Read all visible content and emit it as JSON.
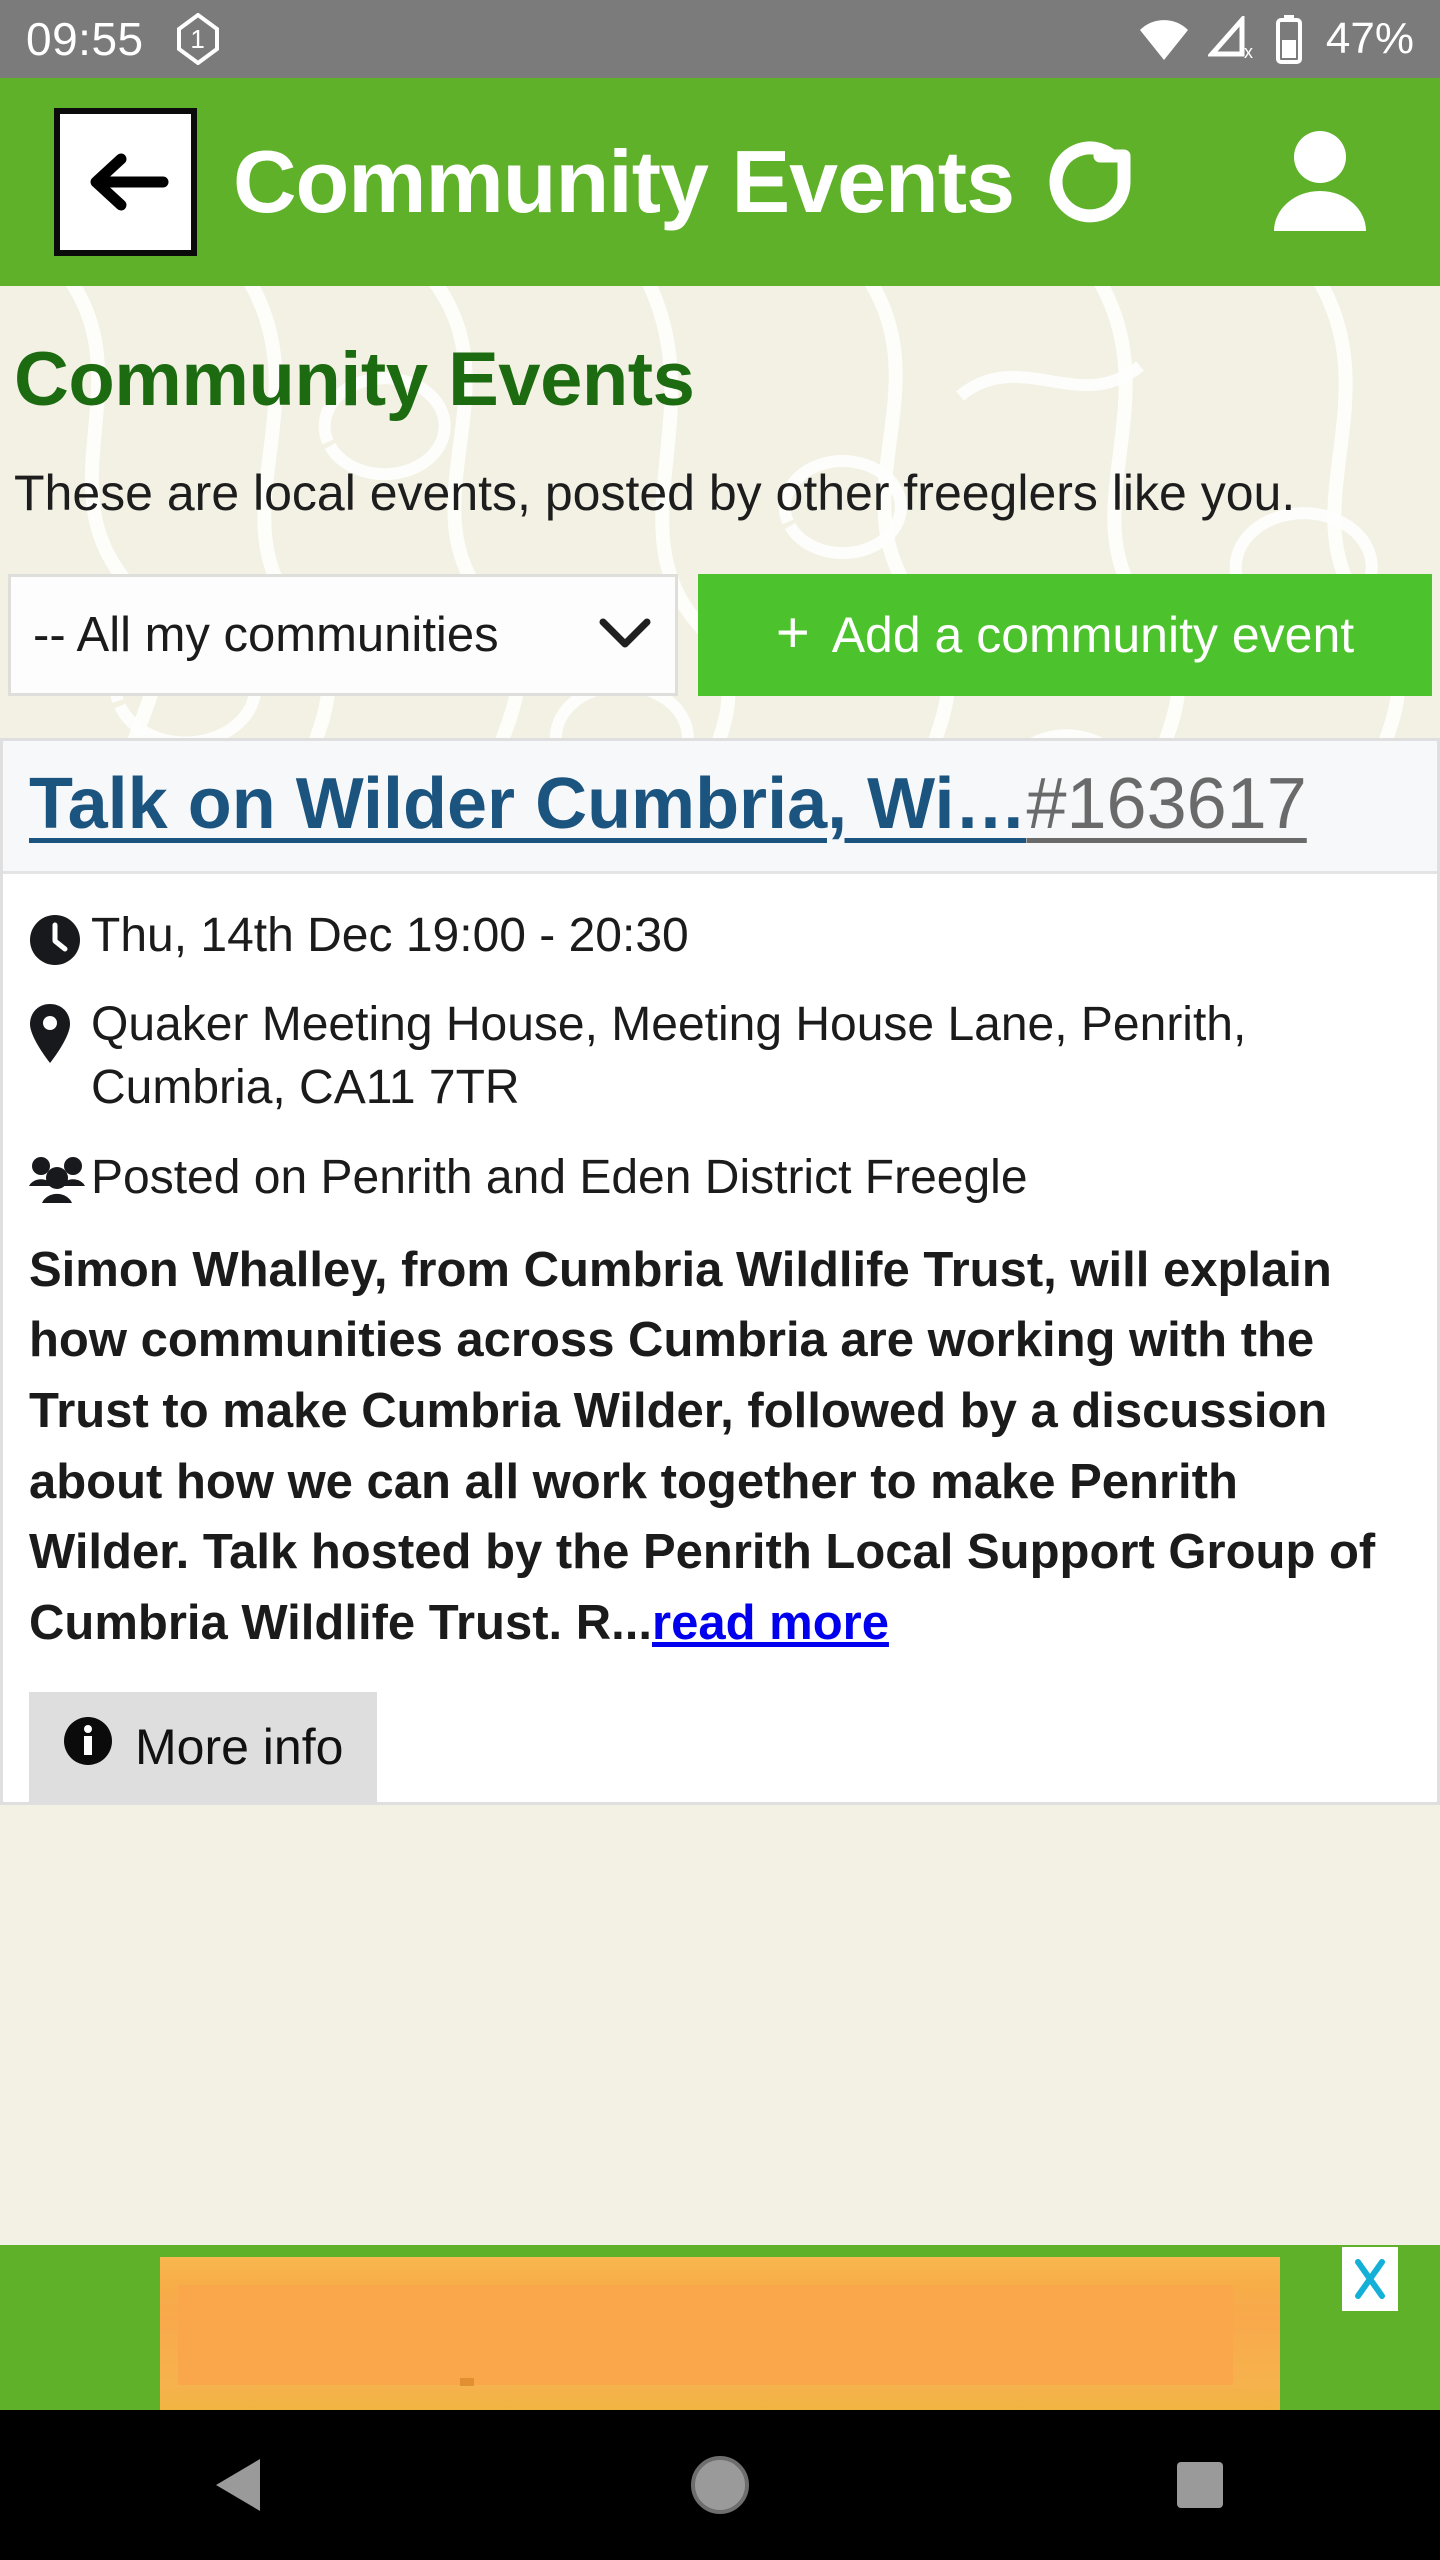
{
  "status_bar": {
    "time": "09:55",
    "notification_badge": "1",
    "battery_percent": "47%",
    "icons": [
      "wifi-icon",
      "no-signal-icon",
      "battery-icon"
    ],
    "bg_color": "#7b7b7b"
  },
  "app_bar": {
    "title": "Community Events",
    "back_label": "←",
    "refresh_icon": "refresh-icon",
    "profile_icon": "profile-icon",
    "bg_color": "#5fb12a"
  },
  "page": {
    "title": "Community Events",
    "description": "These are local events, posted by other freeglers like you.",
    "title_color": "#1d6b11",
    "bg_color": "#f2f1e4"
  },
  "controls": {
    "community_select": {
      "value": "-- All my communities",
      "caret_icon": "chevron-down-icon"
    },
    "add_event_button": {
      "plus": "+",
      "label": "Add a community event",
      "bg_color": "#4cc22c"
    }
  },
  "event_card": {
    "title": "Talk on Wilder Cumbria, Wi…",
    "id": "#163617",
    "title_color": "#1c5480",
    "when": {
      "icon": "clock-icon",
      "text": "Thu, 14th Dec 19:00 - 20:30"
    },
    "where": {
      "icon": "map-pin-icon",
      "text": "Quaker Meeting House, Meeting House Lane, Penrith, Cumbria, CA11 7TR"
    },
    "posted_on": {
      "icon": "group-icon",
      "text": "Posted on Penrith and Eden District Freegle"
    },
    "description": "Simon Whalley, from Cumbria Wildlife Trust, will explain how communities across Cumbria are working with the Trust to make Cumbria Wilder, followed by a discussion about how we can all work together to make Penrith Wilder. Talk hosted by the Penrith Local Support Group of Cumbria Wildlife Trust. R...",
    "read_more_label": "read more",
    "read_more_color": "#0000ee",
    "more_info_button": {
      "icon": "info-icon",
      "label": "More info"
    }
  },
  "ad_banner": {
    "close_label": "X",
    "close_color": "#15b0d8",
    "bg_color": "#5fb12a",
    "panel_color": "#f9a74a"
  },
  "nav_bar": {
    "back_icon": "triangle-back-icon",
    "home_icon": "circle-home-icon",
    "recents_icon": "square-recents-icon",
    "bg_color": "#000000"
  }
}
